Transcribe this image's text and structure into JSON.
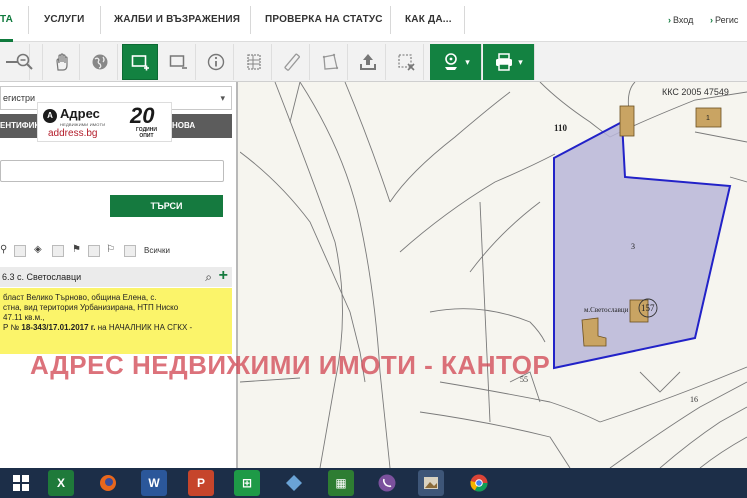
{
  "nav": {
    "items": [
      "ТА",
      "УСЛУГИ",
      "ЖАЛБИ И ВЪЗРАЖЕНИЯ",
      "ПРОВЕРКА НА СТАТУС",
      "КАК ДА..."
    ],
    "login": "Вход",
    "register": "Регис"
  },
  "panel": {
    "select_value": "егистри",
    "tab_left": "ЕНТИФИК",
    "tab_right": "НОВА",
    "search_button": "ТЪРСИ",
    "layers_all": "Всички",
    "result_title": "6.3 с. Светославци",
    "result_lines": [
      "бласт Велико Търново, община Елена, с.",
      "стна, вид територия Урбанизирана, НТП Ниско",
      "47.11 кв.м.,"
    ],
    "result_order_prefix": "Р №",
    "result_order_number": "18-343/17.01.2017 г.",
    "result_order_suffix": "на НАЧАЛНИК НА СГКХ -"
  },
  "logo": {
    "brand": "Адрес",
    "tagline": "НЕДВИЖИМИ ИМОТИ",
    "url": "address.bg",
    "years_number": "20",
    "years_line1": "ГОДИНИ",
    "years_line2": "ОПИТ"
  },
  "map": {
    "kks_label": "ККС 2005 47549",
    "parcel_110": "110",
    "parcel_3": "3",
    "parcel_157": "157",
    "locality": "м.Светославци",
    "parcel_55": "55",
    "parcel_16": "16",
    "building_1": "1",
    "selection_fill": "#b9b6d8",
    "selection_stroke": "#2222c8",
    "building_fill": "#c9a463"
  },
  "watermark": "АДРЕС НЕДВИЖИМИ ИМОТИ - КАНТОР",
  "colors": {
    "accent": "#138241",
    "taskbar": "#1c2e48"
  },
  "taskbar": {
    "apps": [
      "windows-start",
      "excel",
      "firefox",
      "word",
      "powerpoint",
      "excel-green",
      "app-diamond",
      "calculator",
      "viber",
      "app-photo",
      "chrome"
    ]
  }
}
